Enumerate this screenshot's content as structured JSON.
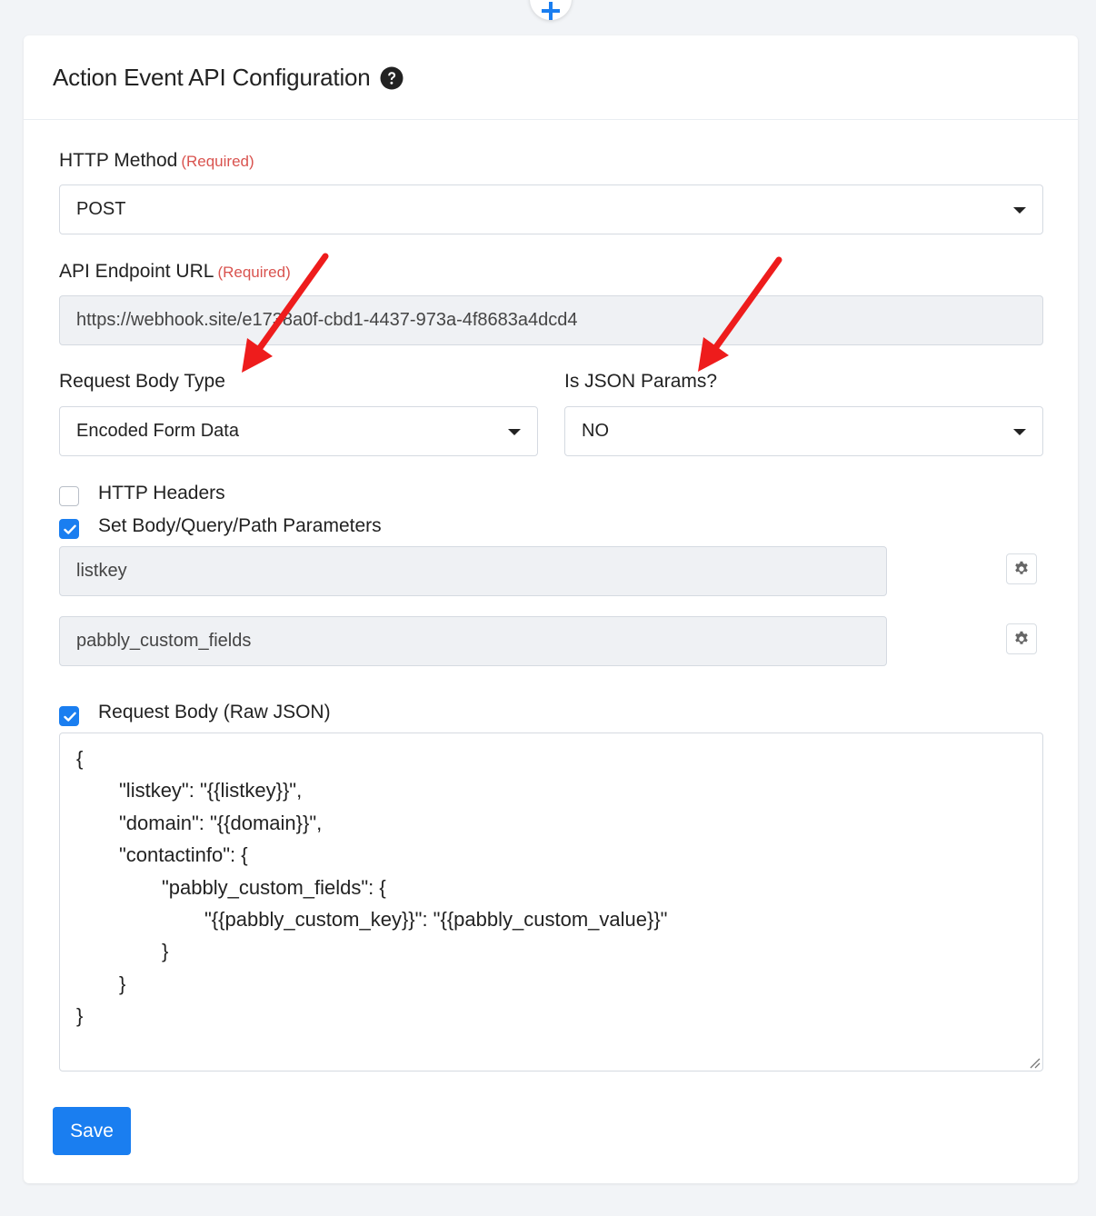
{
  "header": {
    "title": "Action Event API Configuration"
  },
  "http_method": {
    "label": "HTTP Method",
    "required": "(Required)",
    "value": "POST"
  },
  "endpoint": {
    "label": "API Endpoint URL",
    "required": "(Required)",
    "value": "https://webhook.site/e1738a0f-cbd1-4437-973a-4f8683a4dcd4"
  },
  "body_type": {
    "label": "Request Body Type",
    "value": "Encoded Form Data"
  },
  "json_params": {
    "label": "Is JSON Params?",
    "value": "NO"
  },
  "http_headers": {
    "label": "HTTP Headers",
    "checked": false
  },
  "params": {
    "label": "Set Body/Query/Path Parameters",
    "checked": true,
    "fields": [
      "listkey",
      "pabbly_custom_fields"
    ]
  },
  "raw_json": {
    "label": "Request Body (Raw JSON)",
    "checked": true,
    "lines": [
      "{",
      "\t\"listkey\": \"{{listkey}}\",",
      "\t\"domain\": \"{{domain}}\",",
      "\t\"contactinfo\": {",
      "\t\t\"pabbly_custom_fields\": {",
      "\t\t\t\"{{pabbly_custom_key}}\": \"{{pabbly_custom_value}}\"",
      "\t\t}",
      "\t}",
      "}"
    ]
  },
  "save_label": "Save",
  "colors": {
    "primary": "#1a7ef0",
    "required": "#d9534f",
    "annotation_arrow": "#ee1c1c"
  }
}
